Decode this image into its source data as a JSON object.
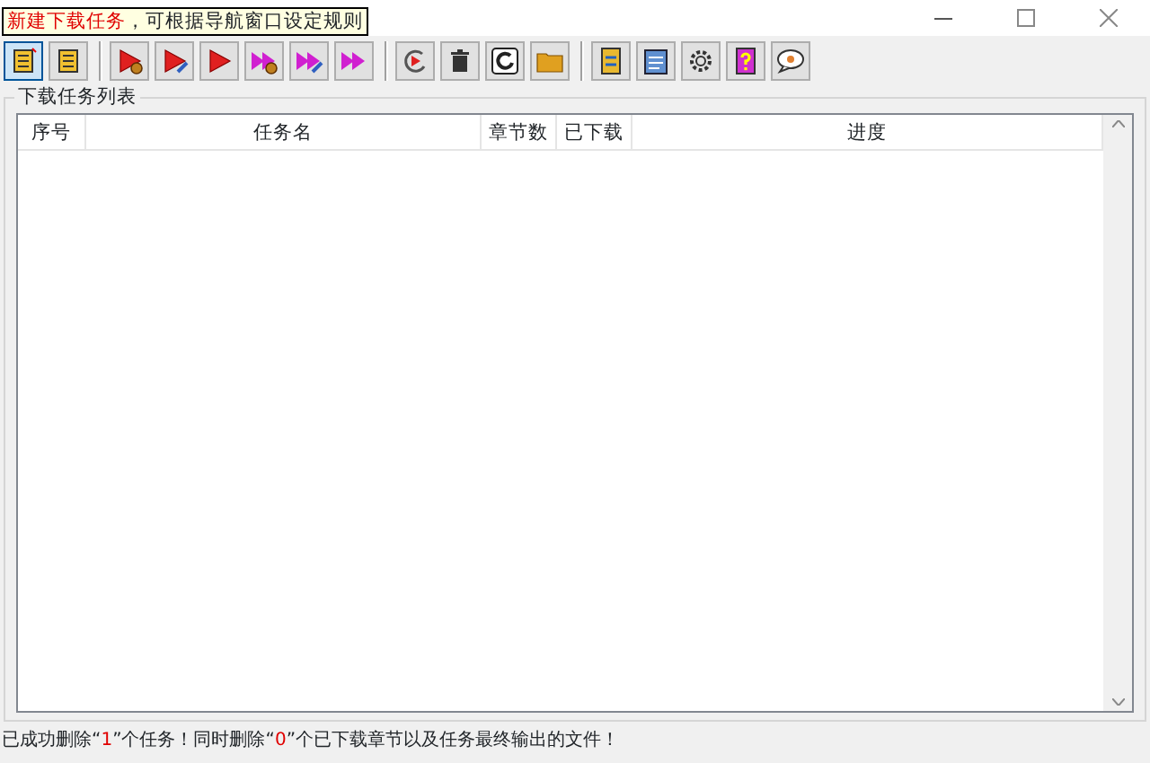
{
  "tooltip": {
    "text": "**新建下载任务**，可根据导航窗口设定规则"
  },
  "toolbar": [
    [
      {
        "kind": "notebook-star",
        "selected": true
      },
      {
        "kind": "notebook",
        "selected": false
      }
    ],
    [
      {
        "kind": "play-gear",
        "selected": false
      },
      {
        "kind": "play-pencil",
        "selected": false
      },
      {
        "kind": "play",
        "selected": false
      },
      {
        "kind": "double-gear",
        "selected": false
      },
      {
        "kind": "double-pencil",
        "selected": false
      },
      {
        "kind": "double",
        "selected": false
      }
    ],
    [
      {
        "kind": "circle-play",
        "selected": false
      },
      {
        "kind": "trash",
        "selected": false
      },
      {
        "kind": "refresh",
        "selected": false
      },
      {
        "kind": "folder",
        "selected": false
      }
    ],
    [
      {
        "kind": "book-arrows",
        "selected": false
      },
      {
        "kind": "notepad",
        "selected": false
      },
      {
        "kind": "gear",
        "selected": false
      },
      {
        "kind": "help-book",
        "selected": false
      },
      {
        "kind": "speech",
        "selected": false
      }
    ]
  ],
  "task_group": {
    "title": "下载任务列表",
    "columns": [
      "序号",
      "任务名",
      "章节数",
      "已下载",
      "进度"
    ]
  },
  "status_bar": [
    {
      "text": "已成功删除“",
      "highlight": false
    },
    {
      "text": "1",
      "highlight": true
    },
    {
      "text": "”个任务！同时删除“",
      "highlight": false
    },
    {
      "text": "0",
      "highlight": true
    },
    {
      "text": "”个已下载章节以及任务最终输出的文件！",
      "highlight": false
    }
  ]
}
